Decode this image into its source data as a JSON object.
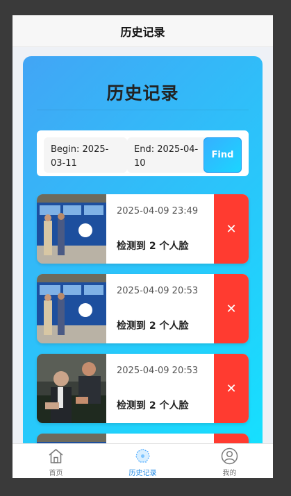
{
  "navbar": {
    "title": "历史记录"
  },
  "card": {
    "title": "历史记录"
  },
  "filter": {
    "begin_label": "Begin: 2025-03-11",
    "end_label": "End: 2025-04-10",
    "find_label": "Find"
  },
  "records": [
    {
      "time": "2025-04-09 23:49",
      "desc": "检测到 2 个人脸",
      "thumb": "bus-photo",
      "delete_icon": "close-icon"
    },
    {
      "time": "2025-04-09 20:53",
      "desc": "检测到 2 个人脸",
      "thumb": "bus-photo",
      "delete_icon": "close-icon"
    },
    {
      "time": "2025-04-09 20:53",
      "desc": "检测到 2 个人脸",
      "thumb": "football-photo",
      "delete_icon": "close-icon"
    },
    {
      "time": "",
      "desc": "",
      "thumb": "bus-photo",
      "delete_icon": "close-icon"
    }
  ],
  "tabbar": {
    "items": [
      {
        "label": "首页",
        "icon": "home-icon"
      },
      {
        "label": "历史记录",
        "icon": "history-icon",
        "active": true
      },
      {
        "label": "我的",
        "icon": "user-icon"
      }
    ]
  },
  "colors": {
    "card_gradient_start": "#42a5f5",
    "card_gradient_end": "#13e4ff",
    "delete_red": "#ff3b30",
    "active_tab": "#1e88e5"
  }
}
